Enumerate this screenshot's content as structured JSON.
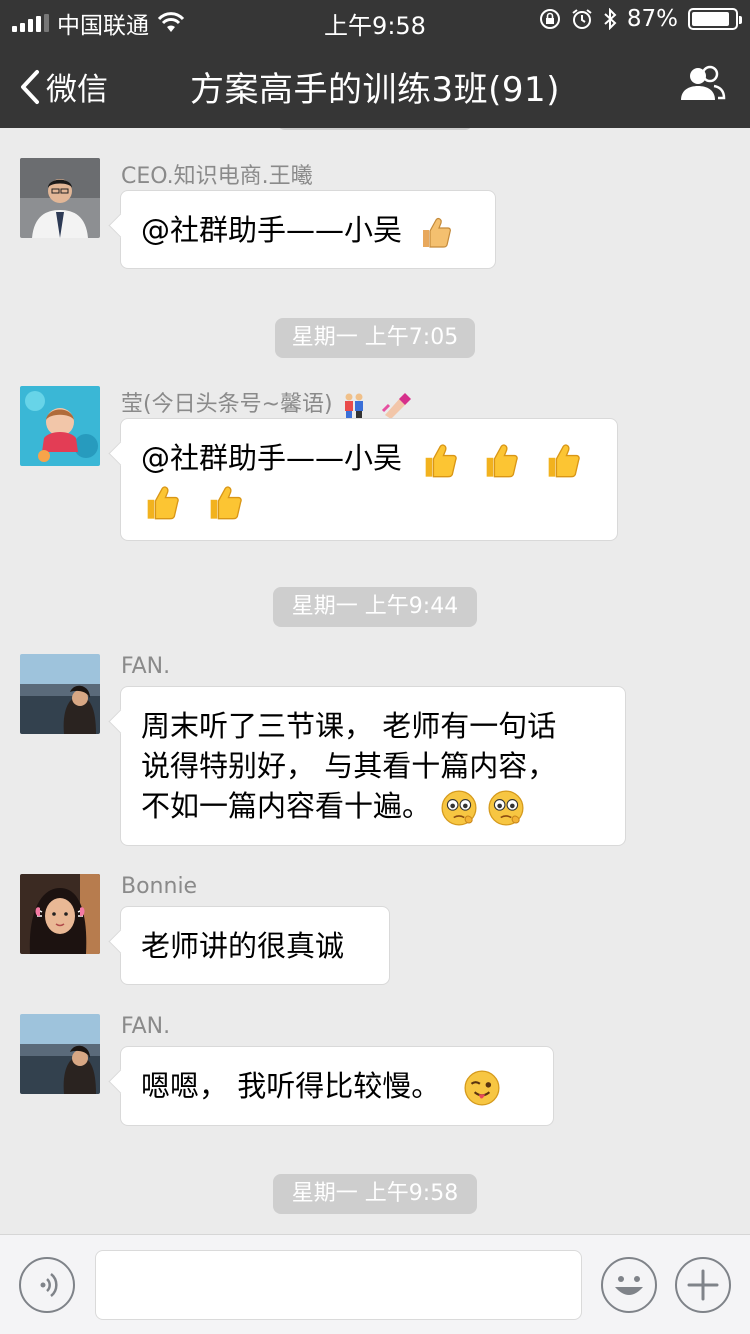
{
  "status_bar": {
    "carrier": "中国联通",
    "time": "上午9:58",
    "battery_percent": "87%",
    "battery_level": 0.87
  },
  "nav": {
    "back_label": "微信",
    "title": "方案高手的训练3班(91)"
  },
  "messages": [
    {
      "sender": "CEO.知识电商.王曦",
      "text": "@社群助手——小吴",
      "emoji": [
        "thumbs-up"
      ]
    },
    {
      "timestamp": "星期一 上午7:05"
    },
    {
      "sender": "莹(今日头条号~馨语)",
      "sender_emoji": [
        "couple",
        "nail-polish"
      ],
      "text": "@社群助手——小吴",
      "emoji": [
        "thumbs-up",
        "thumbs-up",
        "thumbs-up",
        "thumbs-up",
        "thumbs-up"
      ]
    },
    {
      "timestamp": "星期一 上午9:44"
    },
    {
      "sender": "FAN.",
      "lines": [
        "周末听了三节课， 老师有一句话",
        "说得特别好， 与其看十篇内容，",
        "不如一篇内容看十遍。"
      ],
      "emoji": [
        "shy-face",
        "shy-face"
      ]
    },
    {
      "sender": "Bonnie",
      "text": "老师讲的很真诚"
    },
    {
      "sender": "FAN.",
      "text": "嗯嗯， 我听得比较慢。",
      "emoji": [
        "wink-tongue-face"
      ]
    },
    {
      "timestamp": "星期一 上午9:58"
    }
  ],
  "colors": {
    "header_bg": "#363636",
    "chat_bg": "#ebebeb",
    "bubble_bg": "#ffffff",
    "timestamp_pill": "#cecece",
    "input_bar_bg": "#f4f4f6"
  }
}
